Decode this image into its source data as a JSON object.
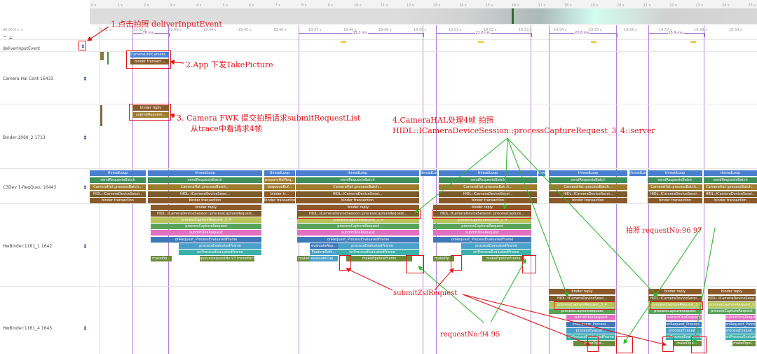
{
  "timeline": {
    "ticks": [
      "0 s",
      "1 s",
      "2 s",
      "3 s",
      "4 s",
      "5 s",
      "6 s",
      "7 s",
      "8 s",
      "9 s",
      "10 s",
      "11 s",
      "12 s",
      "13 s",
      "14 s",
      "15 s",
      "16 s",
      "17 s",
      "18 s",
      "19 s",
      "20 s",
      "21 s",
      "22 s",
      "23 s",
      "24 s",
      "25 s"
    ],
    "secondary_ticks": [
      "00:00:0 s +",
      "19.41 s",
      "19.42 s",
      "19.43 s",
      "19.44 s",
      "19.45 s",
      "19.46 s",
      "19.47 s",
      "19.48 s",
      "19.49 s",
      "19.50 s",
      "19.51 s",
      "19.52 s",
      "19.53 s",
      "19.54 s",
      "19.55 s",
      "19.56 s",
      "19.57 s",
      "19.58 s",
      "19.59 s"
    ],
    "spans": [
      "70 ms",
      "15.1 ms",
      "21.8 ms",
      "22.8 ms",
      "15.9 ms"
    ]
  },
  "lanes": {
    "deliver": "deliverInputEvent",
    "camera_hal": "Camera Hal Cont 16433",
    "binder": "Binder:1069_2 1713",
    "c3dev": "C3Dev 1-ReqQueu 16443",
    "hwbinder1": "HwBinder:1161_1 1642",
    "hwbinder4": "HwBinder:1161_4 1645"
  },
  "slices": {
    "thread_loop": "threadLoop",
    "send_batch": "sendRequestsBatch",
    "cam_hal_batch": "CameraHal::processBatch...",
    "cam_hal_batch_capture": "CameraHal::processBatchCaptureRequests",
    "hidl_session": "HIDL::ICameraDeviceSessi...",
    "hidl_process_capture": "HIDL::ICameraDeviceSession::processCaptureRequest_3_4::server",
    "hidl_process_capture_short": "HIDL::ICameraDeviceSession::processCaptureRequest...",
    "hidl_process_capture_mid": "HIDL::ICameraDeviceSession::processCapture...",
    "binder_transaction": "binder transaction",
    "binder_trans_short": "binder transact...",
    "binder_reply": "binder reply",
    "submit_request": "submitRequest...",
    "camera_unit": "CameraUnitCamera...",
    "prepare": "prepareHalReq...",
    "dequeue": "dequeueBuf...",
    "binder_tr": "binder tr...",
    "process_capture_34": "processCaptureRequest_3_4",
    "process_capture": "processCaptureRequest",
    "submit_one": "submitOneRequest",
    "on_request": "onRequest_ProcessEvaluatedFrame",
    "process_eval": "processEvaluatedFrame",
    "on_process_eval": "onProcessEvaluatedFrame",
    "make_pipeline": "makePipelineFrame",
    "queue_req": "queue(requestNo:93 frameNo:93",
    "make_p": "makePip...",
    "feature": "FeatureSelh...",
    "evaluate_rep": "evaluateRep...",
    "evaluate_cap": "evaluateCap...",
    "process_capture_3": "processCaptureRequest_3",
    "on_request_short": "onRequest_Process...",
    "process_eval_short": "processEvaluat...",
    "make_pipe_short": "makePipel..."
  },
  "annotations": {
    "a1": "1.点击拍照 deliverInputEvent",
    "a2": "2.App 下发TakePicture",
    "a3_line1": "3. Camera FWK 提交拍照请求submitRequestList",
    "a3_line2": "从trace中看请求4帧",
    "a4_line1": "4.CameraHAL处理4帧 拍照",
    "a4_line2": "HIDL::ICameraDeviceSession::processCaptureRequest_3_4::server",
    "a5": "拍照 requestNo:96 97",
    "a6": "submitZslRequest",
    "a7": "requestNo:94 95"
  },
  "colors": {
    "thread_loop": "#4a7fd0",
    "send_batch": "#3f8f5a",
    "cam_hal": "#9e7b2e",
    "hidl": "#7b5a2c",
    "binder": "#8a5a2a",
    "process_34": "#b8c45a",
    "process_capture": "#5ba35b",
    "submit_one": "#e070c0",
    "on_request": "#3e78b8",
    "process_eval": "#4aa0c8",
    "on_process_eval": "#3ab0a8",
    "make_pipeline": "#6a8a3a",
    "annotation": "#e0151b",
    "arrow": "#2eb82e"
  }
}
